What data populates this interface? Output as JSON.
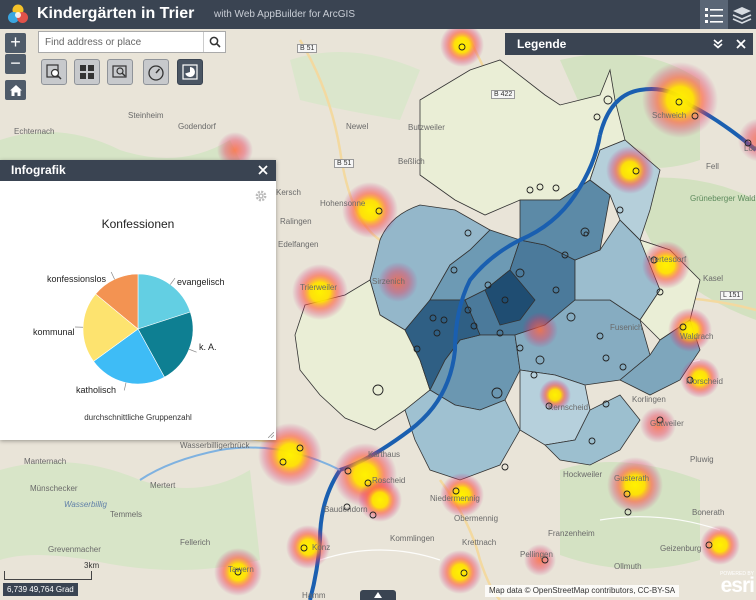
{
  "header": {
    "title": "Kindergärten in Trier",
    "subtitle": "with Web AppBuilder for ArcGIS"
  },
  "search": {
    "placeholder": "Find address or place"
  },
  "zoom": {
    "in_label": "+",
    "out_label": "−"
  },
  "toolbar": {
    "tools": [
      "query-tool",
      "grid-tool",
      "screening-tool",
      "gauge-tool",
      "infographic-tool"
    ],
    "active_tool": "infographic-tool"
  },
  "legend_panel": {
    "title": "Legende"
  },
  "infografik": {
    "title": "Infografik",
    "chart_caption": "durchschnittliche Gruppenzahl"
  },
  "chart_data": {
    "type": "pie",
    "title": "Konfessionen",
    "categories": [
      "evangelisch",
      "k. A.",
      "katholisch",
      "kommunal",
      "konfessionslos"
    ],
    "values": [
      20,
      22,
      23,
      21,
      14
    ],
    "colors": [
      "#63cfe3",
      "#0e7f92",
      "#3ebcf6",
      "#fde36f",
      "#f39352"
    ]
  },
  "map": {
    "places": [
      {
        "name": "Echternach",
        "style": "dark"
      },
      {
        "name": "Steinheim",
        "style": "dark"
      },
      {
        "name": "Godendorf",
        "style": "dark"
      },
      {
        "name": "Newel",
        "style": "dark"
      },
      {
        "name": "Butzweiler",
        "style": "dark"
      },
      {
        "name": "Beßlich",
        "style": "dark"
      },
      {
        "name": "Hohensonne",
        "style": "dark"
      },
      {
        "name": "Kersch",
        "style": "dark"
      },
      {
        "name": "Ralingen",
        "style": "dark"
      },
      {
        "name": "Edelfangen",
        "style": "dark"
      },
      {
        "name": "Trierweiler",
        "style": "dark"
      },
      {
        "name": "Sirzenich",
        "style": "dark"
      },
      {
        "name": "Schweich",
        "style": "dark"
      },
      {
        "name": "Longuich",
        "style": "dark"
      },
      {
        "name": "Fell",
        "style": "dark"
      },
      {
        "name": "Grüneberger Wald",
        "style": "green"
      },
      {
        "name": "Mertesdorf",
        "style": "dark"
      },
      {
        "name": "Kasel",
        "style": "dark"
      },
      {
        "name": "Waldrach",
        "style": "dark"
      },
      {
        "name": "Morscheid",
        "style": "dark"
      },
      {
        "name": "Korlingen",
        "style": "dark"
      },
      {
        "name": "Gusterath",
        "style": "dark"
      },
      {
        "name": "Pluwig",
        "style": "dark"
      },
      {
        "name": "Gutweiler",
        "style": "dark"
      },
      {
        "name": "Kernscheid",
        "style": "dark"
      },
      {
        "name": "Hockweiler",
        "style": "dark"
      },
      {
        "name": "Franzenheim",
        "style": "dark"
      },
      {
        "name": "Niedermennig",
        "style": "dark"
      },
      {
        "name": "Obermennig",
        "style": "dark"
      },
      {
        "name": "Konz",
        "style": "dark"
      },
      {
        "name": "Kommlingen",
        "style": "dark"
      },
      {
        "name": "Krettnach",
        "style": "dark"
      },
      {
        "name": "Pellingen",
        "style": "dark"
      },
      {
        "name": "Ollmuth",
        "style": "dark"
      },
      {
        "name": "Geizenburg",
        "style": "dark"
      },
      {
        "name": "Bonerath",
        "style": "dark"
      },
      {
        "name": "Wasserbilligerbrück",
        "style": "dark"
      },
      {
        "name": "Manternach",
        "style": "dark"
      },
      {
        "name": "Mertert",
        "style": "dark"
      },
      {
        "name": "Münschecker",
        "style": "dark"
      },
      {
        "name": "Wasserbillig",
        "style": "blue"
      },
      {
        "name": "Temmels",
        "style": "dark"
      },
      {
        "name": "Fellerich",
        "style": "dark"
      },
      {
        "name": "Grevenmacher",
        "style": "dark"
      },
      {
        "name": "Tawern",
        "style": "dark"
      },
      {
        "name": "Hamm",
        "style": "dark"
      },
      {
        "name": "Karthaus",
        "style": "dark"
      },
      {
        "name": "Roscheid",
        "style": "dark"
      },
      {
        "name": "Baudendorn",
        "style": "dark"
      },
      {
        "name": "Fusenich",
        "style": "dark"
      }
    ],
    "roads": [
      "B 51",
      "B 422",
      "B 51",
      "L 151"
    ],
    "scale_label": "3km",
    "coordinates": "6,739 49,764 Grad",
    "attribution": "Map data © OpenStreetMap contributors, CC-BY-SA",
    "esri_powered": "POWERED BY",
    "esri_word": "esri"
  }
}
